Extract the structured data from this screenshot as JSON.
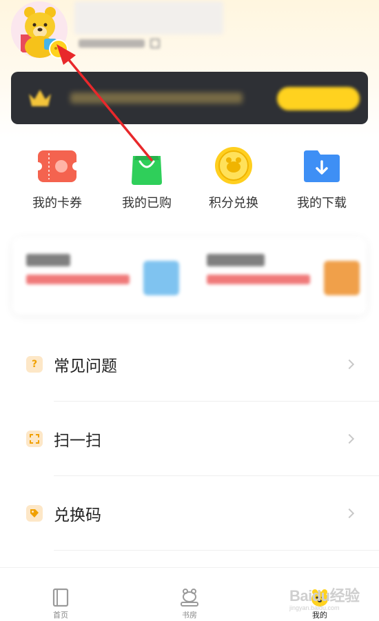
{
  "header": {
    "avatar_icon": "yellow-bear-avatar-icon",
    "badge_icon": "yellow-badge-icon"
  },
  "vip_banner": {
    "icon": "crown-icon"
  },
  "shortcuts": [
    {
      "label": "我的卡券",
      "icon": "coupon-icon",
      "color": "#f4634f"
    },
    {
      "label": "我的已购",
      "icon": "shopping-bag-icon",
      "color": "#2fcf5a"
    },
    {
      "label": "积分兑换",
      "icon": "coin-icon",
      "color": "#ffcf1f"
    },
    {
      "label": "我的下载",
      "icon": "download-folder-icon",
      "color": "#3e8ff5"
    }
  ],
  "menu": [
    {
      "label": "常见问题",
      "icon": "question-icon"
    },
    {
      "label": "扫一扫",
      "icon": "scan-icon"
    },
    {
      "label": "兑换码",
      "icon": "tag-icon"
    }
  ],
  "tabbar": [
    {
      "label": "首页",
      "icon": "book-icon",
      "active": false
    },
    {
      "label": "书房",
      "icon": "bookshelf-bear-icon",
      "active": false
    },
    {
      "label": "我的",
      "icon": "bear-face-icon",
      "active": true
    }
  ],
  "watermark": {
    "line1": "Baidu经验",
    "line2": "jingyan.baidu.com"
  },
  "colors": {
    "accent": "#ffd21f",
    "annotation_arrow": "#e8282b",
    "vip_bg": "#2e3035"
  }
}
